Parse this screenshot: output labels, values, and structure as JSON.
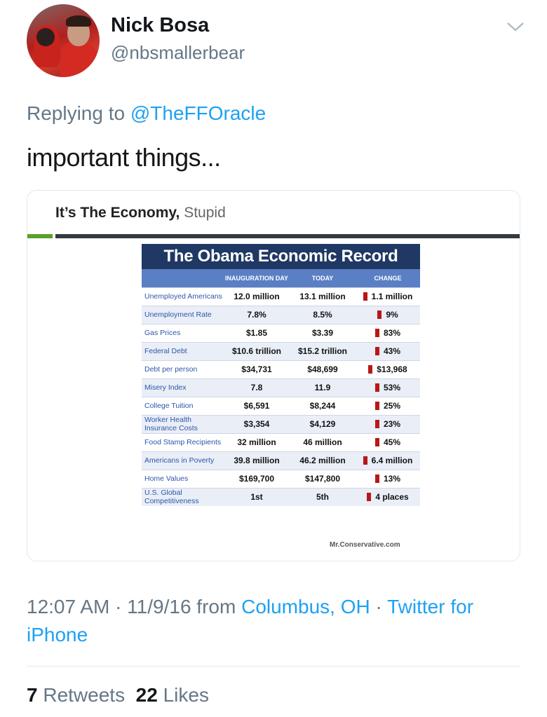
{
  "user": {
    "name": "Nick Bosa",
    "handle": "@nbsmallerbear"
  },
  "reply": {
    "prefix": "Replying to ",
    "target": "@TheFFOracle"
  },
  "tweet_text": "important things...",
  "card": {
    "title_bold": "It’s The Economy,",
    "title_light": "Stupid",
    "table_title": "The Obama Economic Record",
    "headers": [
      "",
      "INAUGURATION DAY",
      "TODAY",
      "CHANGE"
    ],
    "rows": [
      {
        "label": "Unemployed Americans",
        "inauguration": "12.0 million",
        "today": "13.1 million",
        "change": "1.1 million"
      },
      {
        "label": "Unemployment Rate",
        "inauguration": "7.8%",
        "today": "8.5%",
        "change": "9%"
      },
      {
        "label": "Gas Prices",
        "inauguration": "$1.85",
        "today": "$3.39",
        "change": "83%"
      },
      {
        "label": "Federal Debt",
        "inauguration": "$10.6 trillion",
        "today": "$15.2 trillion",
        "change": "43%"
      },
      {
        "label": "Debt per person",
        "inauguration": "$34,731",
        "today": "$48,699",
        "change": "$13,968"
      },
      {
        "label": "Misery Index",
        "inauguration": "7.8",
        "today": "11.9",
        "change": "53%"
      },
      {
        "label": "College Tuition",
        "inauguration": "$6,591",
        "today": "$8,244",
        "change": "25%"
      },
      {
        "label": "Worker Health Insurance Costs",
        "inauguration": "$3,354",
        "today": "$4,129",
        "change": "23%"
      },
      {
        "label": "Food Stamp Recipients",
        "inauguration": "32 million",
        "today": "46 million",
        "change": "45%"
      },
      {
        "label": "Americans in Poverty",
        "inauguration": "39.8 million",
        "today": "46.2 million",
        "change": "6.4 million"
      },
      {
        "label": "Home Values",
        "inauguration": "$169,700",
        "today": "$147,800",
        "change": "13%"
      },
      {
        "label": "U.S. Global Competitiveness",
        "inauguration": "1st",
        "today": "5th",
        "change": "4 places"
      }
    ],
    "watermark": "Mr.Conservative.com"
  },
  "timestamp": {
    "time": "12:07 AM · 11/9/16 from ",
    "location": "Columbus, OH",
    "separator": " · ",
    "source": "Twitter for iPhone"
  },
  "stats": {
    "retweets_count": "7",
    "retweets_label": "Retweets",
    "likes_count": "22",
    "likes_label": "Likes"
  },
  "colors": {
    "link": "#1da1f2",
    "secondary_text": "#657786",
    "table_title_bg": "#1f3864",
    "table_header_bg": "#5b7fc4",
    "arrow": "#b81818"
  },
  "icons": {
    "menu": "chevron-down-icon",
    "change_arrow": "up-arrow-icon"
  }
}
